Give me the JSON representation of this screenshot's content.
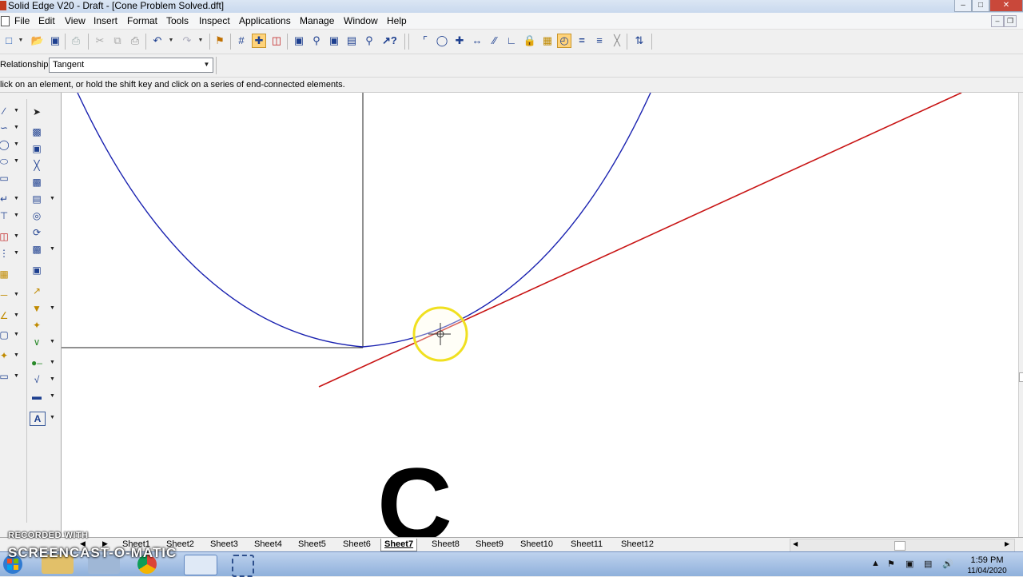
{
  "window": {
    "title": "Solid Edge V20 - Draft - [Cone Problem Solved.dft]"
  },
  "menu": [
    "File",
    "Edit",
    "View",
    "Insert",
    "Format",
    "Tools",
    "Inspect",
    "Applications",
    "Manage",
    "Window",
    "Help"
  ],
  "ribbon": {
    "relationship_label": "Relationship:",
    "relationship_value": "Tangent"
  },
  "prompt": {
    "text": "lick on an element, or hold the shift key and click on a series of end-connected elements."
  },
  "toolbar_icons": [
    "new-icon",
    "open-icon",
    "save-icon",
    "print-icon",
    "cut-icon",
    "copy-icon",
    "paste-icon",
    "undo-icon",
    "redo-icon",
    "select-tool-icon",
    "grid-icon",
    "snap-icon",
    "intellisketch-icon",
    "zoom-area-icon",
    "zoom-icon",
    "fit-icon",
    "pan-icon",
    "zoom-tool-icon",
    "whats-this-icon",
    "connect-icon",
    "concentric-icon",
    "horizontal-vertical-icon",
    "collinear-icon",
    "parallel-icon",
    "perpendicular-icon",
    "lock-icon",
    "rigid-set-icon",
    "tangent-icon",
    "equal-icon",
    "symmetric-icon",
    "symmetry-axis-icon",
    "set-axis-icon"
  ],
  "canvas": {
    "stroke_colors": {
      "curve": "#1a22b0",
      "tangent_line": "#c81414",
      "axes": "#222222",
      "highlight": "#f0e020"
    },
    "large_letter": "C"
  },
  "sheets": [
    "Sheet1",
    "Sheet2",
    "Sheet3",
    "Sheet4",
    "Sheet5",
    "Sheet6",
    "Sheet7",
    "Sheet8",
    "Sheet9",
    "Sheet10",
    "Sheet11",
    "Sheet12"
  ],
  "active_sheet": "Sheet7",
  "taskbar": {
    "time": "1:59 PM",
    "date": "11/04/2020"
  },
  "watermark": {
    "line1": "RECORDED WITH",
    "line2": "SCREENCAST-O-MATIC"
  }
}
